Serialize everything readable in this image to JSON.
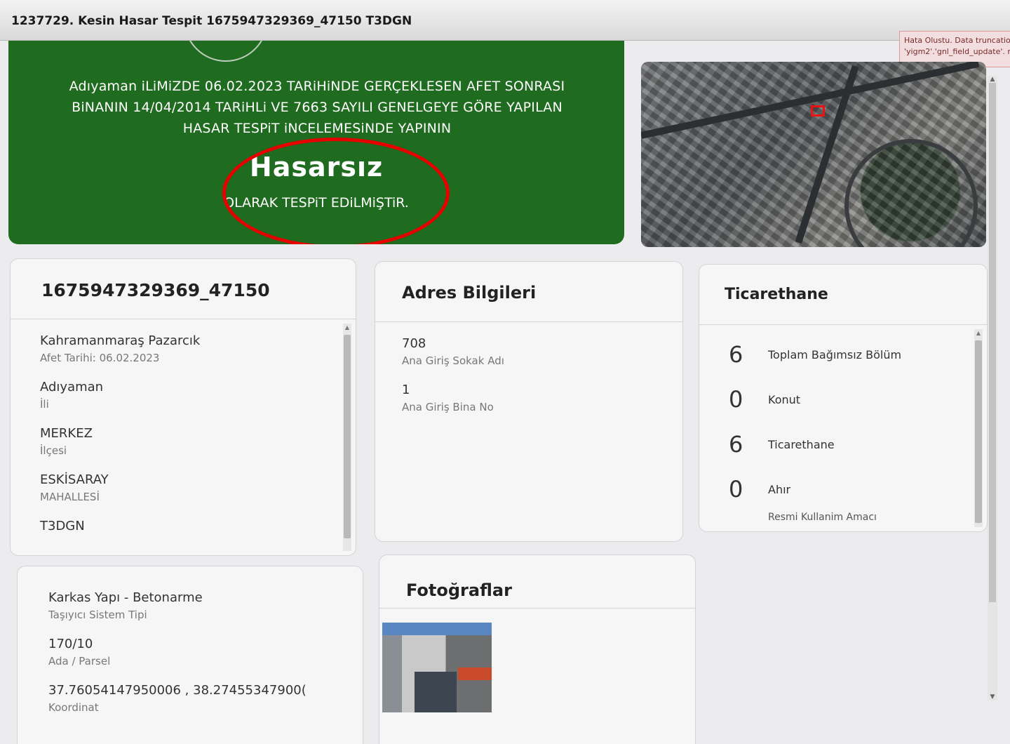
{
  "window": {
    "title": "1237729. Kesin Hasar Tespit 1675947329369_47150 T3DGN"
  },
  "error_toast": {
    "line1": "Hata Olustu. Data truncation",
    "line2": "'yigm2'.'gnl_field_update'. n"
  },
  "banner": {
    "text": "Adıyaman iLiMiZDE 06.02.2023 TARiHiNDE GERÇEKLESEN AFET SONRASI BiNANIN 14/04/2014 TARiHLi VE 7663 SAYILI GENELGEYE GÖRE YAPILAN HASAR TESPiT iNCELEMESiNDE YAPININ",
    "status": "Hasarsız",
    "subtext": "OLARAK TESPiT EDiLMiŞTiR.",
    "bg_color": "#1f6b1f",
    "highlight_color": "#e60000"
  },
  "building_card": {
    "title": "1675947329369_47150",
    "fields": [
      {
        "value": "Kahramanmaraş Pazarcık",
        "label": "Afet Tarihi: 06.02.2023"
      },
      {
        "value": "Adıyaman",
        "label": "İli"
      },
      {
        "value": "MERKEZ",
        "label": "İlçesi"
      },
      {
        "value": "ESKİSARAY",
        "label": "MAHALLESİ"
      },
      {
        "value": "T3DGN",
        "label": ""
      }
    ]
  },
  "address_card": {
    "title": "Adres Bilgileri",
    "fields": [
      {
        "value": "708",
        "label": "Ana Giriş Sokak Adı"
      },
      {
        "value": "1",
        "label": "Ana Giriş Bina No"
      }
    ]
  },
  "usage_card": {
    "title": "Ticarethane",
    "stats": [
      {
        "value": "6",
        "label": "Toplam Bağımsız Bölüm"
      },
      {
        "value": "0",
        "label": "Konut"
      },
      {
        "value": "6",
        "label": "Ticarethane"
      },
      {
        "value": "0",
        "label": "Ahır"
      }
    ],
    "cut_label": "Resmi Kullanim Amacı"
  },
  "structure_card": {
    "fields": [
      {
        "value": "Karkas Yapı - Betonarme",
        "label": "Taşıyıcı Sistem Tipi"
      },
      {
        "value": "170/10",
        "label": "Ada / Parsel"
      },
      {
        "value": "37.76054147950006 , 38.27455347900(",
        "label": "Koordinat"
      }
    ]
  },
  "photos_card": {
    "title": "Fotoğraflar"
  },
  "icons": {
    "scroll_up": "▲",
    "scroll_down": "▼"
  }
}
